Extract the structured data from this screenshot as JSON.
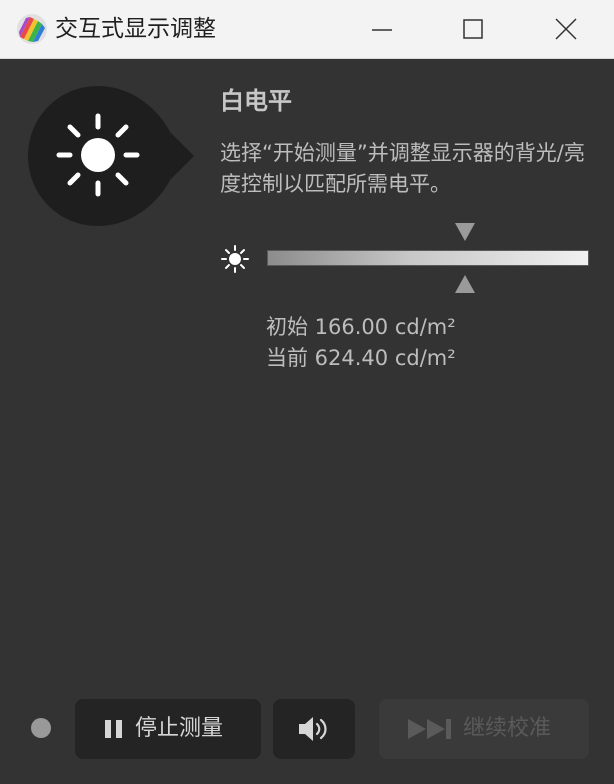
{
  "window": {
    "title": "交互式显示调整"
  },
  "panel": {
    "heading": "白电平",
    "instruction": "选择“开始测量”并调整显示器的背光/亮度控制以匹配所需电平。",
    "level_fraction": 0.615
  },
  "readings": {
    "initial": "初始 166.00 cd/m²",
    "current": "当前 624.40 cd/m²"
  },
  "controls": {
    "stop_label": "停止测量",
    "continue_label": "继续校准",
    "status_color": "#999999"
  },
  "icons": {
    "app": "color-wheel-icon",
    "minimize": "minimize-icon",
    "maximize": "maximize-icon",
    "close": "close-icon",
    "badge": "sun-icon",
    "brightness": "brightness-icon",
    "pause": "pause-icon",
    "sound": "speaker-icon",
    "continue": "skip-forward-icon"
  }
}
